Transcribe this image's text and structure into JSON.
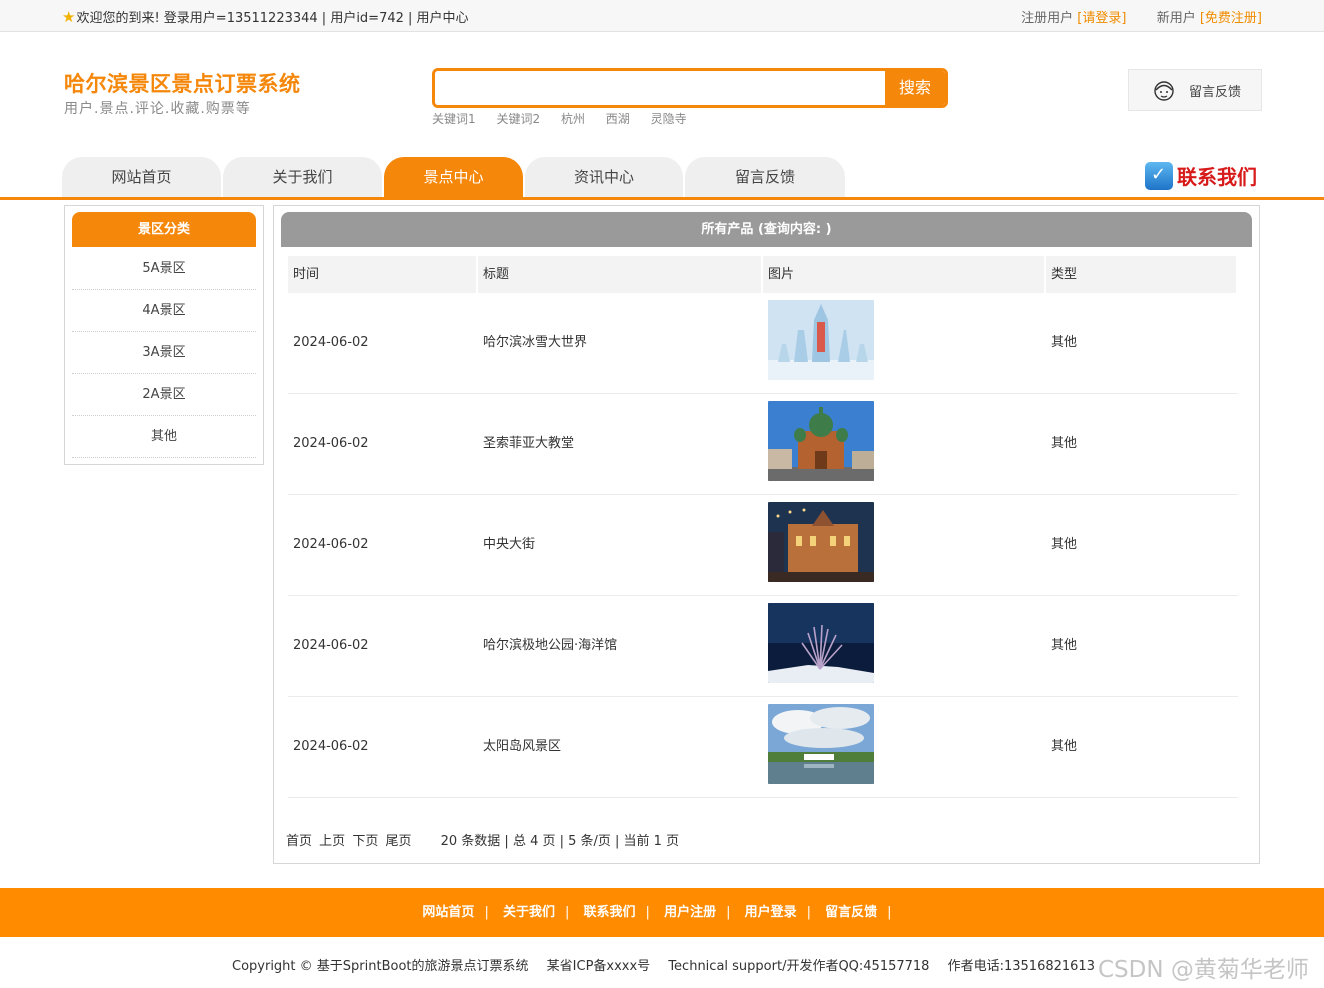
{
  "topbar": {
    "welcome": "欢迎您的到来!  登录用户=13511223344 | 用户id=742 | 用户中心",
    "register_label": "注册用户",
    "login_link": "[请登录]",
    "new_user_label": "新用户",
    "free_register_link": "[免费注册]"
  },
  "header": {
    "title": "哈尔滨景区景点订票系统",
    "subtitle": "用户.景点.评论.收藏.购票等",
    "search_button": "搜索",
    "search_value": "",
    "hotwords": [
      "关键词1",
      "关键词2",
      "杭州",
      "西湖",
      "灵隐寺"
    ],
    "feedback_label": "留言反馈"
  },
  "nav": {
    "items": [
      "网站首页",
      "关于我们",
      "景点中心",
      "资讯中心",
      "留言反馈"
    ],
    "active_index": 2,
    "contact_label": "联系我们"
  },
  "sidebar": {
    "title": "景区分类",
    "items": [
      "5A景区",
      "4A景区",
      "3A景区",
      "2A景区",
      "其他"
    ]
  },
  "main": {
    "title": "所有产品 (查询内容: )",
    "columns": [
      "时间",
      "标题",
      "图片",
      "类型"
    ],
    "rows": [
      {
        "date": "2024-06-02",
        "title": "哈尔滨冰雪大世界",
        "type": "其他"
      },
      {
        "date": "2024-06-02",
        "title": "圣索菲亚大教堂",
        "type": "其他"
      },
      {
        "date": "2024-06-02",
        "title": "中央大街",
        "type": "其他"
      },
      {
        "date": "2024-06-02",
        "title": "哈尔滨极地公园·海洋馆",
        "type": "其他"
      },
      {
        "date": "2024-06-02",
        "title": "太阳岛风景区",
        "type": "其他"
      }
    ],
    "pager": {
      "first": "首页",
      "prev": "上页",
      "next": "下页",
      "last": "尾页",
      "info": "20 条数据 | 总 4 页 | 5 条/页 | 当前 1 页"
    }
  },
  "footer": {
    "links": [
      "网站首页",
      "关于我们",
      "联系我们",
      "用户注册",
      "用户登录",
      "留言反馈"
    ],
    "copyright": "Copyright © 基于SprintBoot的旅游景点订票系统",
    "icp": "某省ICP备xxxx号",
    "support": "Technical support/开发作者QQ:45157718",
    "phone": "作者电话:13516821613",
    "watermark": "CSDN @黄菊华老师"
  },
  "colors": {
    "accent": "#f5870a",
    "footer": "#ff8b00",
    "panel_head": "#9a9a9a"
  }
}
